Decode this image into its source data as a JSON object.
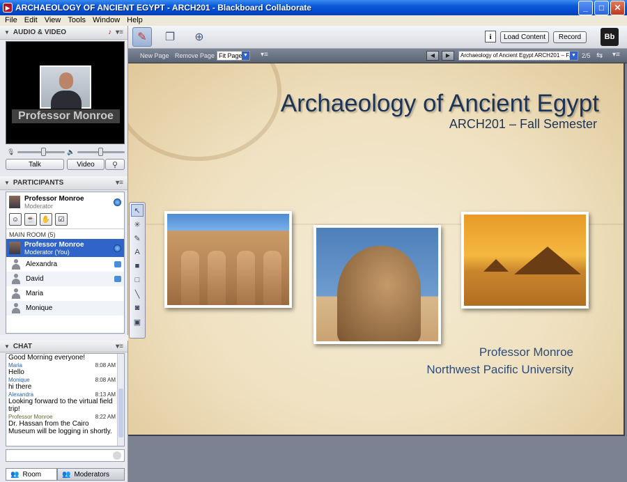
{
  "window": {
    "title": "ARCHAEOLOGY OF ANCIENT EGYPT - ARCH201 - Blackboard Collaborate",
    "minimize": "_",
    "maximize": "□",
    "close": "✕"
  },
  "menu": [
    "File",
    "Edit",
    "View",
    "Tools",
    "Window",
    "Help"
  ],
  "audio_video": {
    "header": "AUDIO & VIDEO",
    "video_label": "Professor Monroe",
    "talk_label": "Talk",
    "video_button_label": "Video"
  },
  "participants": {
    "header": "PARTICIPANTS",
    "me": {
      "name": "Professor Monroe",
      "role": "Moderator"
    },
    "room_label": "MAIN ROOM (5)",
    "list": [
      {
        "name": "Professor Monroe",
        "role": "Moderator (You)",
        "selected": true
      },
      {
        "name": "Alexandra",
        "chat": true
      },
      {
        "name": "David",
        "chat": true
      },
      {
        "name": "Maria",
        "chat": false
      },
      {
        "name": "Monique",
        "chat": false
      }
    ]
  },
  "chat": {
    "header": "CHAT",
    "messages": [
      {
        "sender": "",
        "time": "",
        "text": "Good Morning everyone!"
      },
      {
        "sender": "Maria",
        "time": "8:08 AM",
        "text": "Hello"
      },
      {
        "sender": "Monique",
        "time": "8:08 AM",
        "text": "hi there"
      },
      {
        "sender": "Alexandra",
        "time": "8:13 AM",
        "text": "Looking forward to the virtual field trip!"
      },
      {
        "sender": "Professor Monroe",
        "time": "8:22 AM",
        "text": "Dr. Hassan from the Cairo Museum will be logging in shortly."
      }
    ],
    "tabs": [
      "Room",
      "Moderators"
    ]
  },
  "toolbar": {
    "load_content": "Load Content",
    "record": "Record",
    "info": "i",
    "logo": "Bb",
    "logo_caption": "Blackboard"
  },
  "page_toolbar": {
    "new_page": "New Page",
    "remove_page": "Remove Page",
    "fit": "Fit Page",
    "slide_select": "Archaeology of Ancient Egypt ARCH201 – F...",
    "page_count": "2/5"
  },
  "slide": {
    "title": "Archaeology of Ancient Egypt",
    "subtitle": "ARCH201 – Fall Semester",
    "presenter": "Professor Monroe",
    "university": "Northwest Pacific University"
  },
  "icons": {
    "whiteboard": "whiteboard-icon",
    "app_share": "application-sharing-icon",
    "web_tour": "web-tour-icon"
  }
}
